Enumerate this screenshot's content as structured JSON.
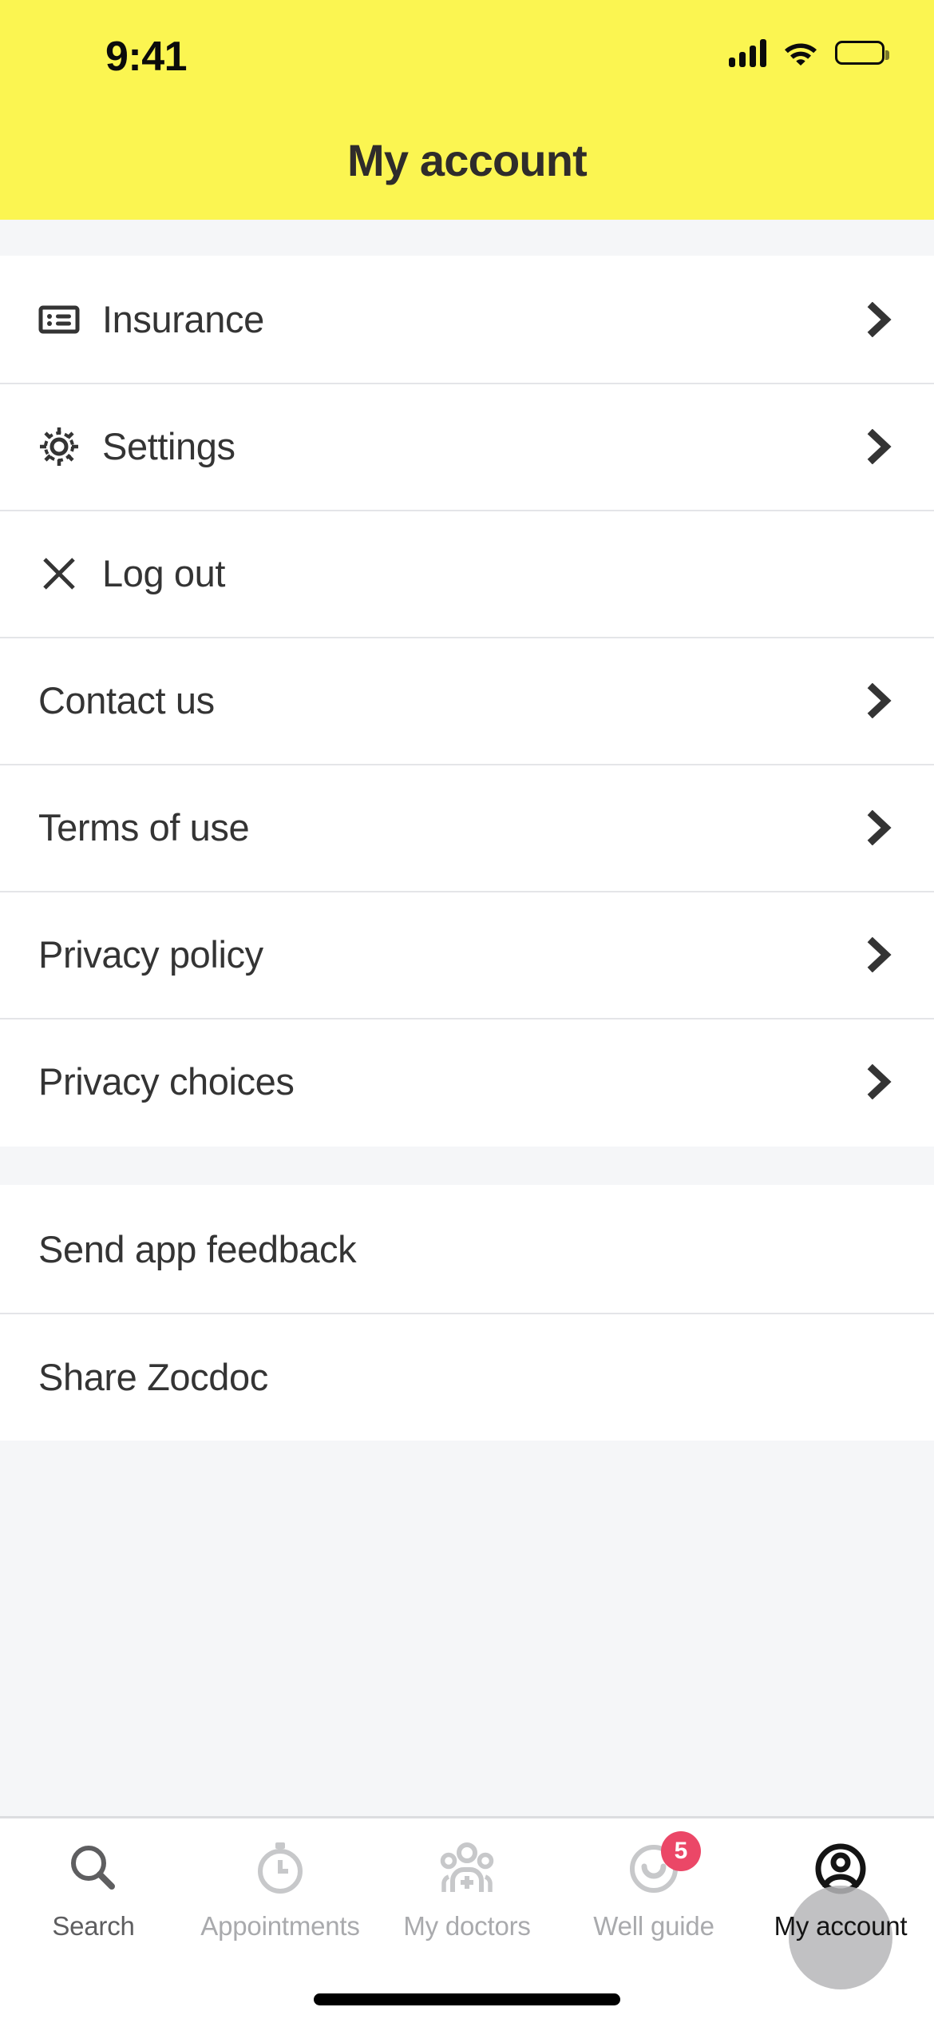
{
  "status_bar": {
    "time": "9:41",
    "cellular_icon": "cellular-signal-icon",
    "wifi_icon": "wifi-icon",
    "battery_icon": "battery-full-icon"
  },
  "header": {
    "title": "My account",
    "background_color": "#FBF551",
    "title_color": "#2F2C2B"
  },
  "sections": [
    {
      "id": "account-section",
      "rows": [
        {
          "label": "Insurance",
          "icon": "insurance-card-icon",
          "chevron": true
        },
        {
          "label": "Settings",
          "icon": "gear-icon",
          "chevron": true
        },
        {
          "label": "Log out",
          "icon": "close-x-icon",
          "chevron": false
        },
        {
          "label": "Contact us",
          "icon": null,
          "chevron": true
        },
        {
          "label": "Terms of use",
          "icon": null,
          "chevron": true
        },
        {
          "label": "Privacy policy",
          "icon": null,
          "chevron": true
        },
        {
          "label": "Privacy choices",
          "icon": null,
          "chevron": true
        }
      ]
    },
    {
      "id": "app-section",
      "rows": [
        {
          "label": "Send app feedback",
          "icon": null,
          "chevron": false
        },
        {
          "label": "Share Zocdoc",
          "icon": null,
          "chevron": false
        }
      ]
    }
  ],
  "tab_bar": {
    "items": [
      {
        "label": "Search",
        "icon": "search-icon",
        "state": "mid",
        "badge": null
      },
      {
        "label": "Appointments",
        "icon": "stopwatch-icon",
        "state": "dim",
        "badge": null
      },
      {
        "label": "My doctors",
        "icon": "people-plus-icon",
        "state": "dim",
        "badge": null
      },
      {
        "label": "Well guide",
        "icon": "smiley-circle-icon",
        "state": "dim",
        "badge": "5"
      },
      {
        "label": "My account",
        "icon": "account-circle-icon",
        "state": "active",
        "badge": null
      }
    ],
    "badge_color": "#EB4767",
    "active_color": "#141414",
    "inactive_color": "#A9AAAD"
  },
  "home_indicator": "home-indicator-bar"
}
